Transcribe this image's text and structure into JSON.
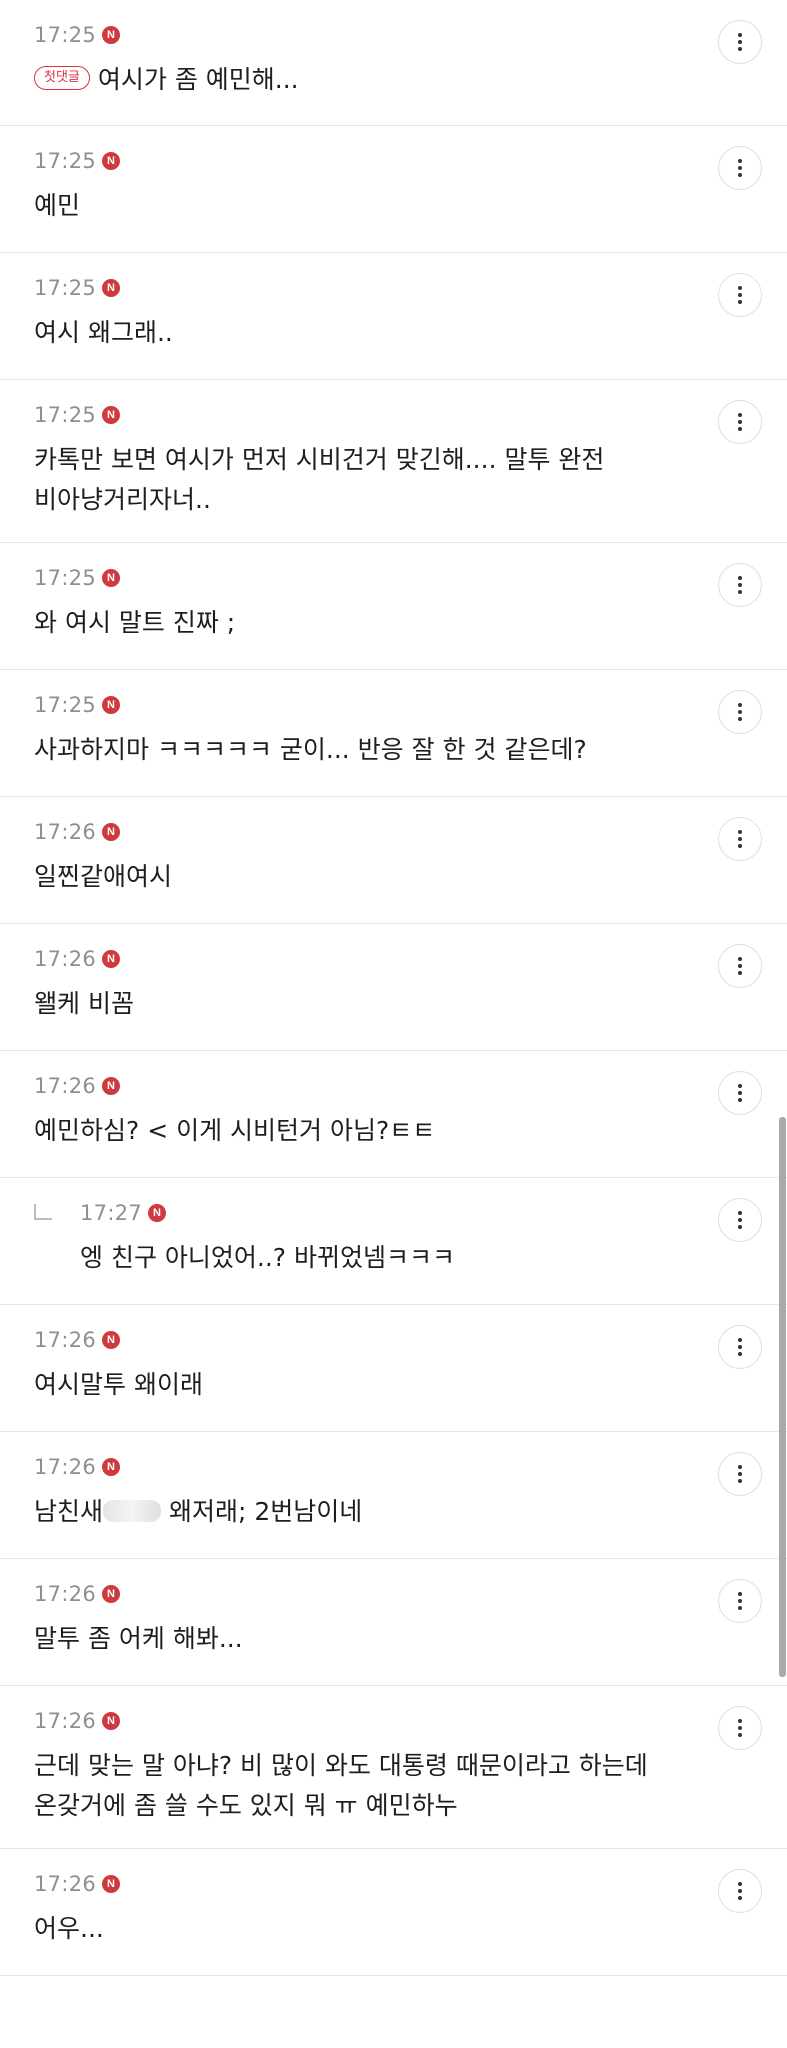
{
  "first_comment_badge": "첫댓글",
  "comments": [
    {
      "time": "17:25",
      "badge": "N",
      "text": "여시가 좀 예민해...",
      "first": true
    },
    {
      "time": "17:25",
      "badge": "N",
      "text": "예민"
    },
    {
      "time": "17:25",
      "badge": "N",
      "text": "여시 왜그래.."
    },
    {
      "time": "17:25",
      "badge": "N",
      "text": "카톡만 보면 여시가 먼저 시비건거 맞긴해.... 말투 완전 비아냥거리자너.."
    },
    {
      "time": "17:25",
      "badge": "N",
      "text": "와 여시 말트 진짜 ;"
    },
    {
      "time": "17:25",
      "badge": "N",
      "text": "사과하지마 ㅋㅋㅋㅋㅋ 굳이... 반응 잘 한 것 같은데?"
    },
    {
      "time": "17:26",
      "badge": "N",
      "text": "일찐같애여시"
    },
    {
      "time": "17:26",
      "badge": "N",
      "text": "왤케 비꼼"
    },
    {
      "time": "17:26",
      "badge": "N",
      "text": "예민하심? < 이게 시비턴거 아님?ㅌㅌ"
    },
    {
      "time": "17:27",
      "badge": "N",
      "text": "엥 친구 아니었어..? 바뀌었넴ㅋㅋㅋ",
      "reply": true
    },
    {
      "time": "17:26",
      "badge": "N",
      "text": "여시말투 왜이래"
    },
    {
      "time": "17:26",
      "badge": "N",
      "text_before": "남친새",
      "text_after": " 왜저래; 2번남이네",
      "blurred": true
    },
    {
      "time": "17:26",
      "badge": "N",
      "text": "말투 좀 어케 해봐..."
    },
    {
      "time": "17:26",
      "badge": "N",
      "text": "근데 맞는 말 아냐? 비 많이 와도 대통령 때문이라고 하는데 온갖거에 좀 쓸 수도 있지 뭐 ㅠ 예민하누"
    },
    {
      "time": "17:26",
      "badge": "N",
      "text": "어우..."
    }
  ],
  "colors": {
    "new_badge": "#cf3a3e",
    "first_badge": "#d9333d",
    "divider": "#e6e6e6"
  },
  "icons": {
    "more": "more-vertical-icon",
    "new": "new-badge-icon",
    "reply": "reply-arrow-icon"
  }
}
